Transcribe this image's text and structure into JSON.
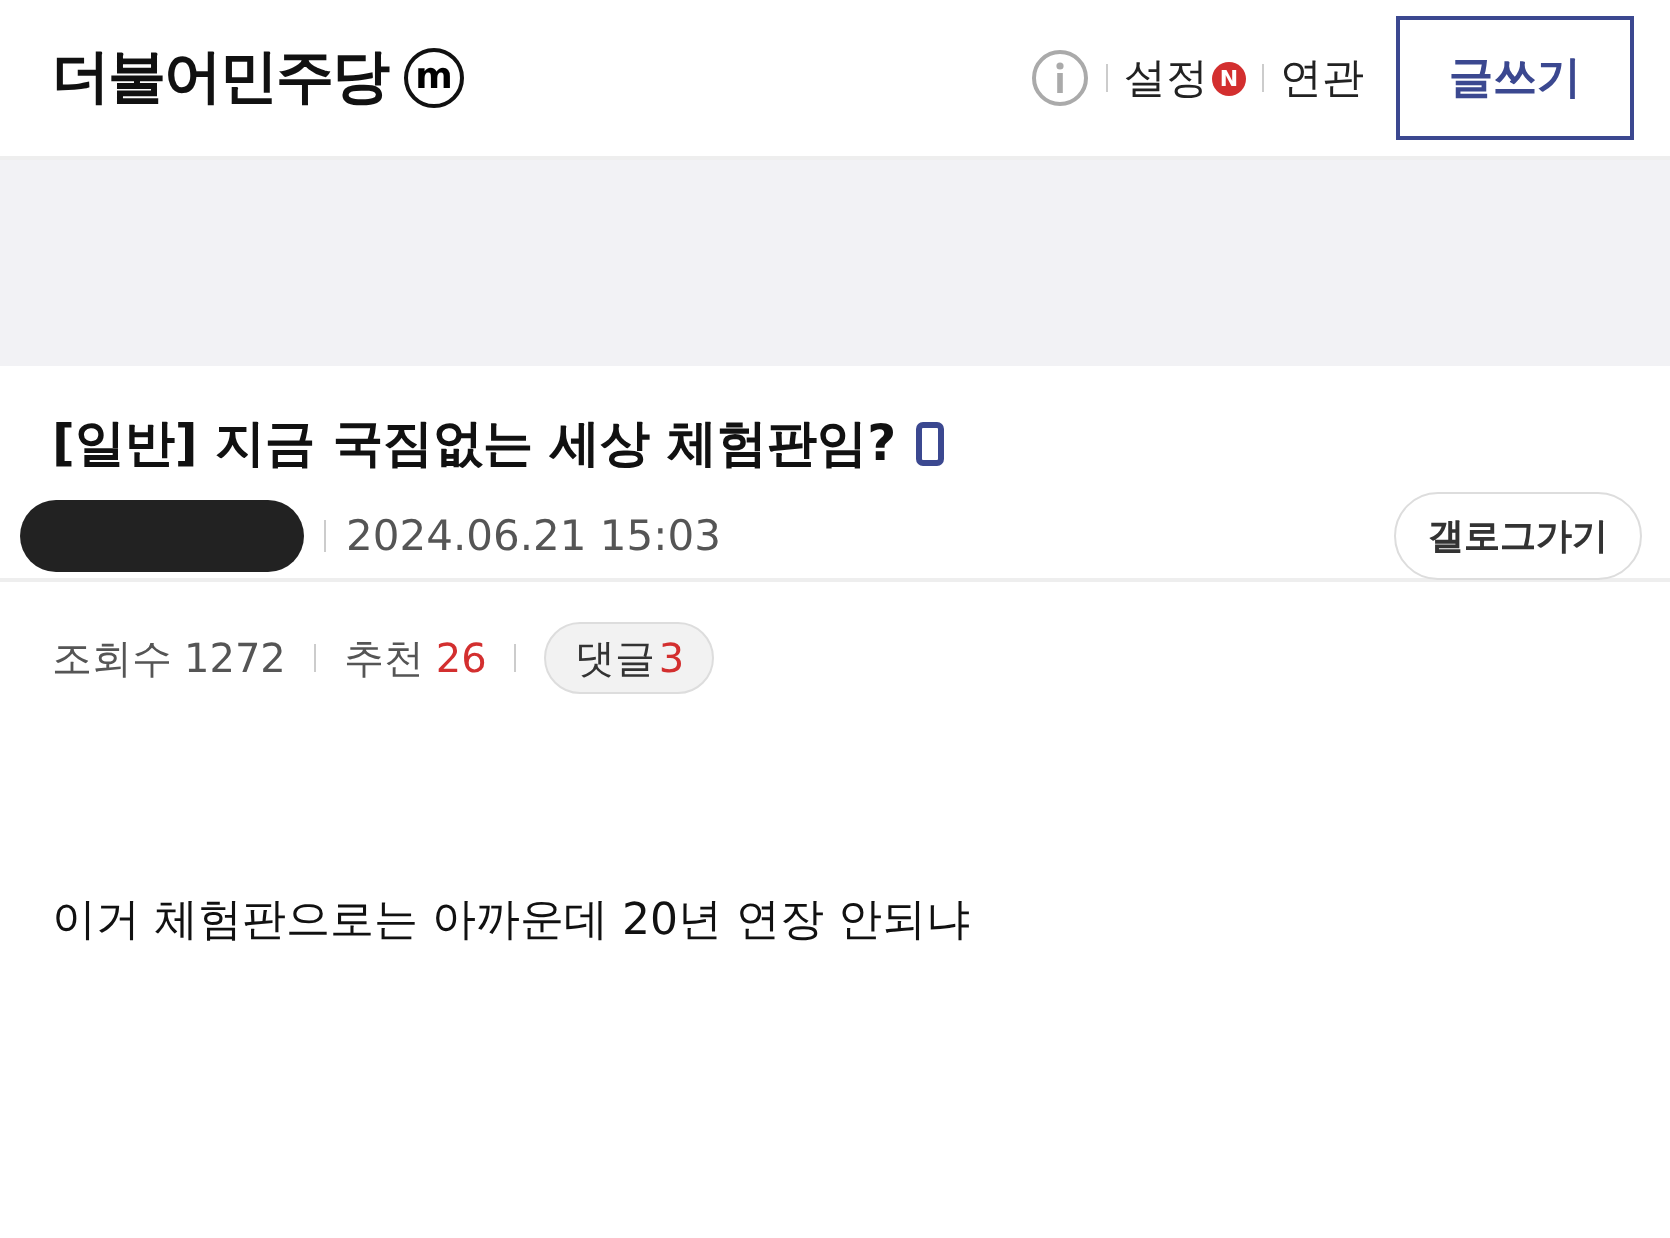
{
  "header": {
    "title": "더불어민주당",
    "title_badge": "m",
    "links": [
      {
        "label": "설정",
        "badge": "N"
      },
      {
        "label": "연관"
      }
    ],
    "write_button": "글쓰기"
  },
  "post": {
    "title": "[일반] 지금 국짐없는 세상 체험판임?",
    "date": "2024.06.21 15:03",
    "gallery_button": "갤로그가기",
    "stats": [
      {
        "label": "조회수",
        "value": "1272",
        "kind": "plain"
      },
      {
        "label": "추천",
        "value": "26",
        "kind": "red"
      }
    ],
    "comments": {
      "label": "댓글",
      "count": "3"
    },
    "body": "이거 체험판으로는 아까운데 20년 연장 안되냐"
  }
}
